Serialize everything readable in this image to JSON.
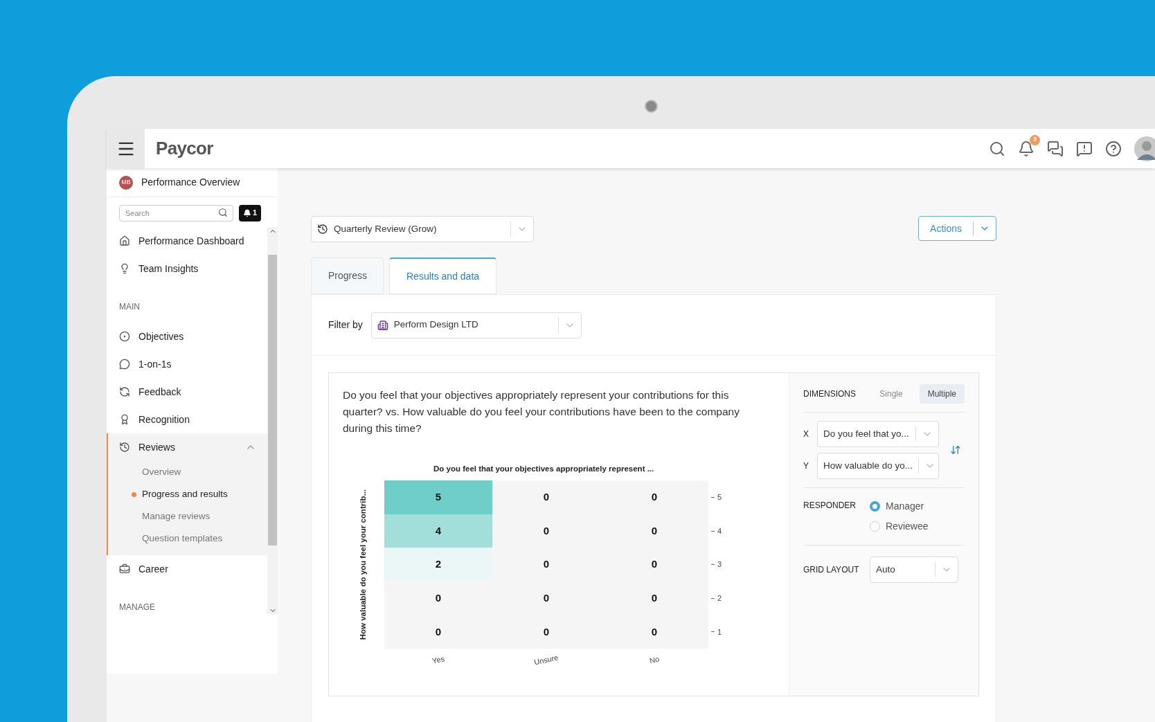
{
  "header": {
    "logo": "Paycor",
    "notification_count": "3"
  },
  "sidebar": {
    "profile": {
      "initials": "MB",
      "title": "Performance Overview"
    },
    "search": {
      "placeholder": "Search"
    },
    "alert_count": "1",
    "items": [
      {
        "kind": "link",
        "label": "Performance Dashboard"
      },
      {
        "kind": "link",
        "label": "Team Insights"
      },
      {
        "kind": "section",
        "label": "MAIN"
      },
      {
        "kind": "link",
        "label": "Objectives"
      },
      {
        "kind": "link",
        "label": "1-on-1s"
      },
      {
        "kind": "link",
        "label": "Feedback"
      },
      {
        "kind": "link",
        "label": "Recognition"
      },
      {
        "kind": "group",
        "label": "Reviews",
        "expanded": true,
        "children": [
          {
            "label": "Overview",
            "selected": false
          },
          {
            "label": "Progress and results",
            "selected": true
          },
          {
            "label": "Manage reviews",
            "selected": false
          },
          {
            "label": "Question templates",
            "selected": false
          }
        ]
      },
      {
        "kind": "link",
        "label": "Career"
      },
      {
        "kind": "section",
        "label": "MANAGE"
      }
    ]
  },
  "review_select": {
    "value": "Quarterly Review (Grow)"
  },
  "actions_button": "Actions",
  "tabs": [
    {
      "label": "Progress",
      "selected": false
    },
    {
      "label": "Results and data",
      "selected": true
    }
  ],
  "filter": {
    "label": "Filter by",
    "value": "Perform Design LTD"
  },
  "question": {
    "text": "Do you feel that your objectives appropriately represent your contributions for this quarter? vs. How valuable do you feel your contributions have been to the company during this time?"
  },
  "heatmap": {
    "title": "Do you feel that your objectives appropriately represent ...",
    "y_title": "How valuable do you feel your contrib...",
    "x_labels": [
      "Yes",
      "Unsure",
      "No"
    ],
    "y_ticks": [
      "5",
      "4",
      "3",
      "2",
      "1"
    ],
    "rows": [
      [
        {
          "value": "5",
          "color": "#6fcfc8"
        },
        {
          "value": "0",
          "color": "#f5f5f5"
        },
        {
          "value": "0",
          "color": "#f5f5f5"
        }
      ],
      [
        {
          "value": "4",
          "color": "#a2dfda"
        },
        {
          "value": "0",
          "color": "#f5f5f5"
        },
        {
          "value": "0",
          "color": "#f5f5f5"
        }
      ],
      [
        {
          "value": "2",
          "color": "#eaf7f6"
        },
        {
          "value": "0",
          "color": "#f5f5f5"
        },
        {
          "value": "0",
          "color": "#f5f5f5"
        }
      ],
      [
        {
          "value": "0",
          "color": "#f5f5f5"
        },
        {
          "value": "0",
          "color": "#f5f5f5"
        },
        {
          "value": "0",
          "color": "#f5f5f5"
        }
      ],
      [
        {
          "value": "0",
          "color": "#f5f5f5"
        },
        {
          "value": "0",
          "color": "#f5f5f5"
        },
        {
          "value": "0",
          "color": "#f5f5f5"
        }
      ]
    ]
  },
  "settings": {
    "dimensions": {
      "label": "DIMENSIONS",
      "options": [
        {
          "label": "Single",
          "selected": false
        },
        {
          "label": "Multiple",
          "selected": true
        }
      ]
    },
    "axes": [
      {
        "label": "X",
        "value": "Do you feel that yo..."
      },
      {
        "label": "Y",
        "value": "How valuable do yo..."
      }
    ],
    "responder": {
      "label": "RESPONDER",
      "options": [
        {
          "label": "Manager",
          "selected": true
        },
        {
          "label": "Reviewee",
          "selected": false
        }
      ]
    },
    "grid_layout": {
      "label": "GRID LAYOUT",
      "value": "Auto"
    }
  }
}
